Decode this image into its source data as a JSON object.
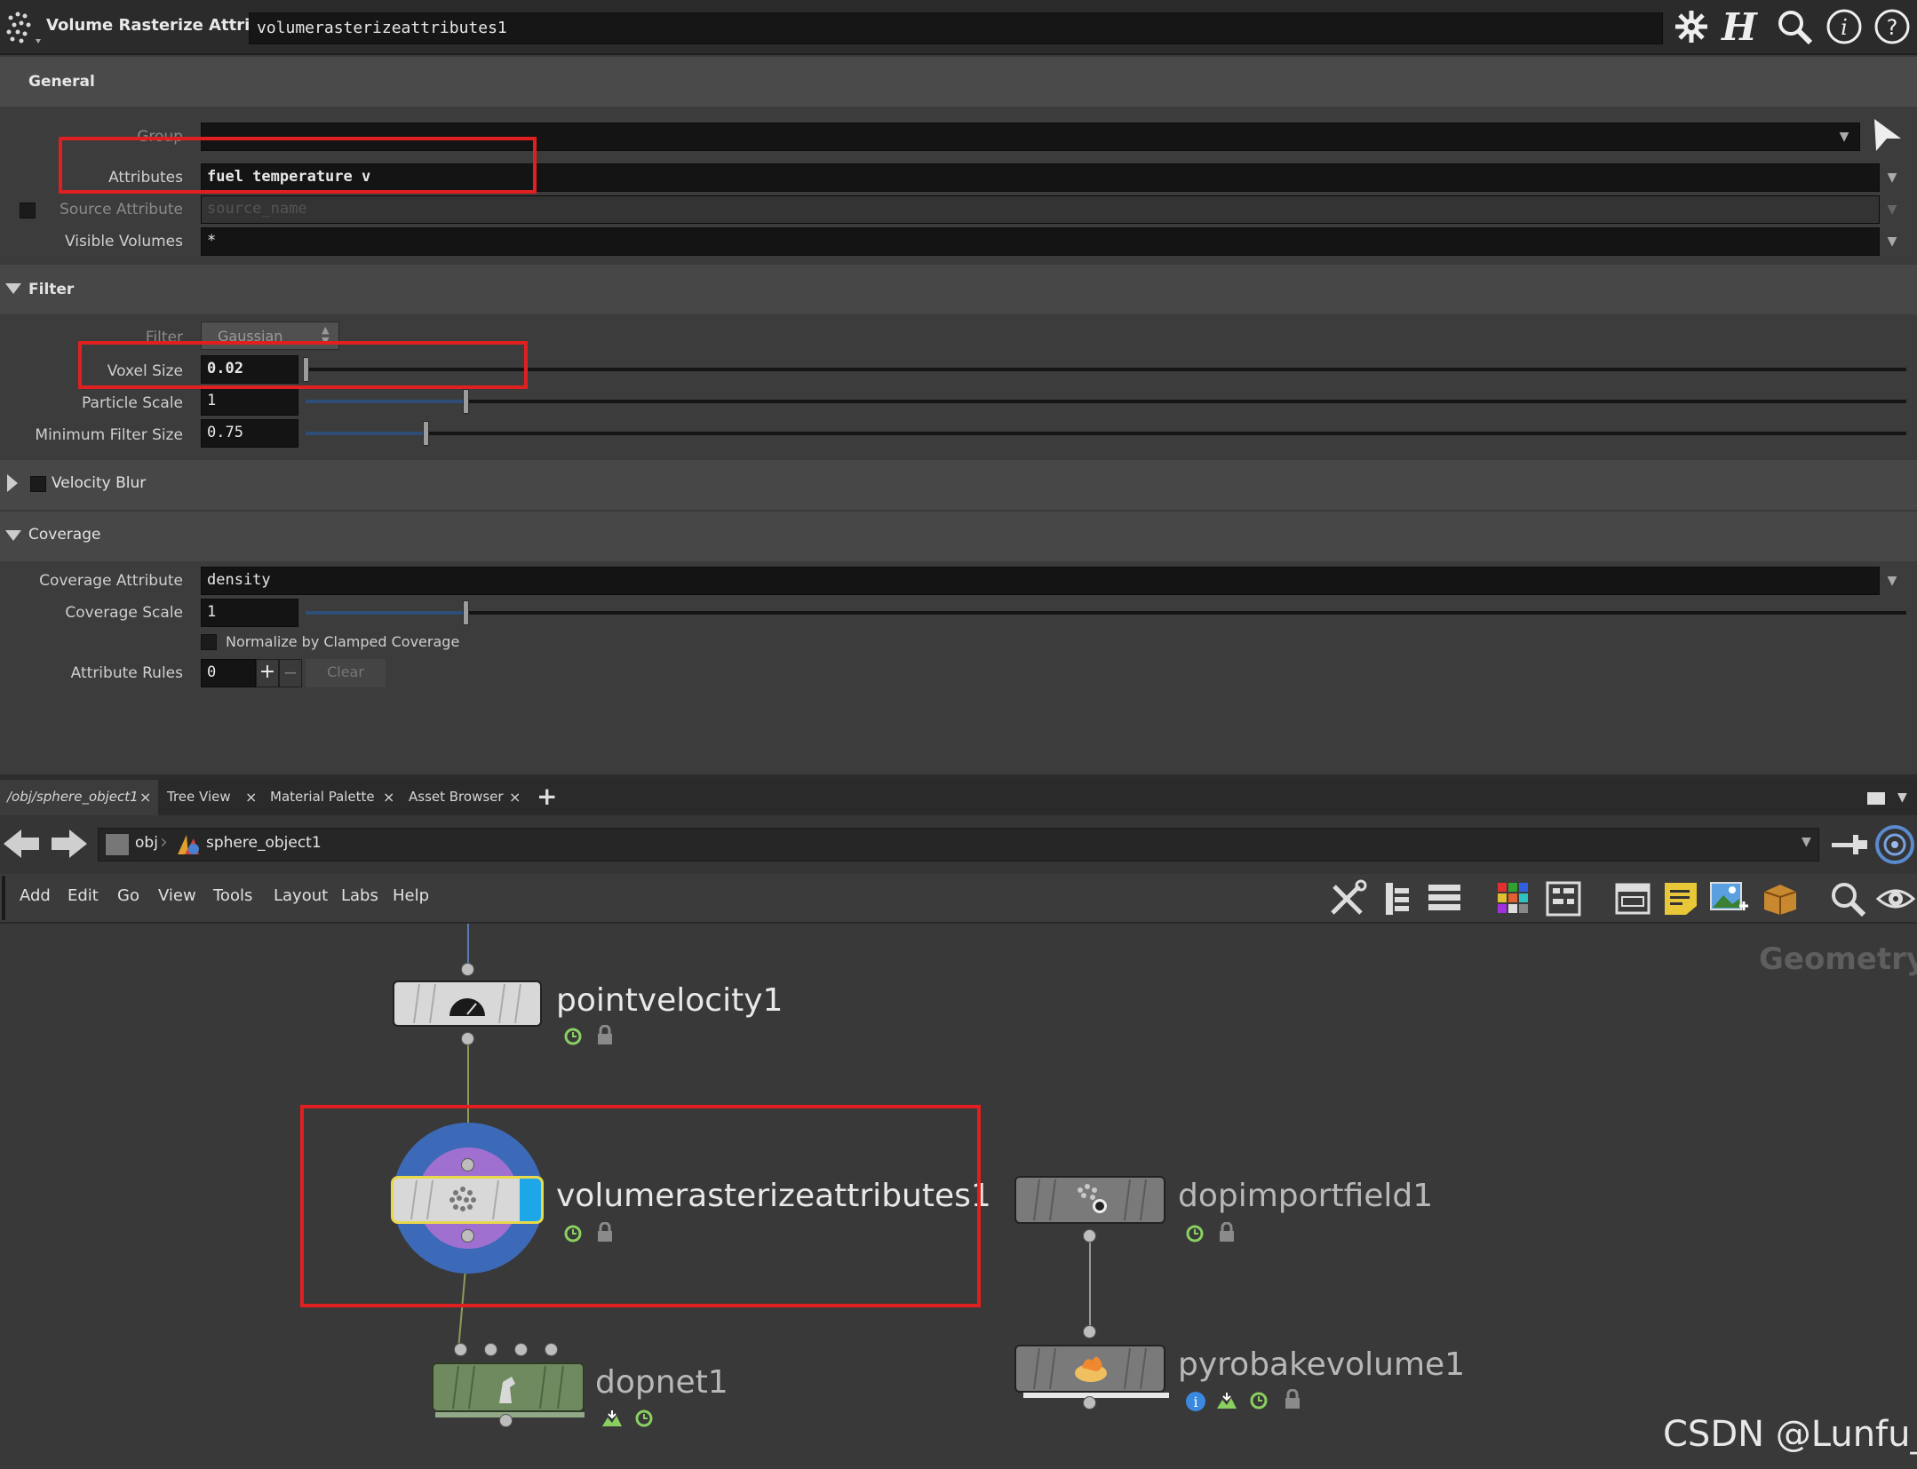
{
  "header": {
    "node_type": "Volume Rasterize Attributes",
    "node_name": "volumerasterizeattributes1",
    "icons": [
      "gear-icon",
      "houdini-h-icon",
      "search-icon",
      "info-icon",
      "help-icon"
    ]
  },
  "params": {
    "general_tab": "General",
    "group_label": "Group",
    "group_value": "",
    "attributes_label": "Attributes",
    "attributes_value": "fuel temperature v",
    "source_attr_label": "Source Attribute",
    "source_attr_placeholder": "source_name",
    "visible_volumes_label": "Visible Volumes",
    "visible_volumes_value": "*",
    "filter_section": "Filter",
    "filter_label": "Filter",
    "filter_value": "Gaussian",
    "voxel_size_label": "Voxel Size",
    "voxel_size_value": "0.02",
    "voxel_size_level": 0.0,
    "particle_scale_label": "Particle Scale",
    "particle_scale_value": "1",
    "particle_scale_level": 0.1,
    "min_filter_label": "Minimum Filter Size",
    "min_filter_value": "0.75",
    "min_filter_level": 0.075,
    "velocity_blur_label": "Velocity Blur",
    "coverage_section": "Coverage",
    "coverage_attr_label": "Coverage Attribute",
    "coverage_attr_value": "density",
    "coverage_scale_label": "Coverage Scale",
    "coverage_scale_value": "1",
    "coverage_scale_level": 0.1,
    "normalize_label": "Normalize by Clamped Coverage",
    "attribute_rules_label": "Attribute Rules",
    "attribute_rules_value": "0",
    "plus": "+",
    "minus": "−",
    "clear_label": "Clear"
  },
  "tabs": [
    {
      "label": "/obj/sphere_object1",
      "close": "×"
    },
    {
      "label": "Tree View",
      "close": "×"
    },
    {
      "label": "Material Palette",
      "close": "×"
    },
    {
      "label": "Asset Browser",
      "close": "×"
    }
  ],
  "add_tab": "+",
  "path": {
    "obj": "obj",
    "object": "sphere_object1"
  },
  "menu": [
    "Add",
    "Edit",
    "Go",
    "View",
    "Tools",
    "Layout",
    "Labs",
    "Help"
  ],
  "network": {
    "context_label": "Geometry",
    "nodes": {
      "pointvelocity": "pointvelocity1",
      "volraster": "volumerasterizeattributes1",
      "dopnet": "dopnet1",
      "dopimport": "dopimportfield1",
      "pyrobake": "pyrobakevolume1"
    }
  },
  "watermark": "CSDN @Lunfu_",
  "colors": {
    "highlight": "#e02020",
    "selected_outline": "#e8d84a",
    "display_flag": "#1ea7e8"
  }
}
